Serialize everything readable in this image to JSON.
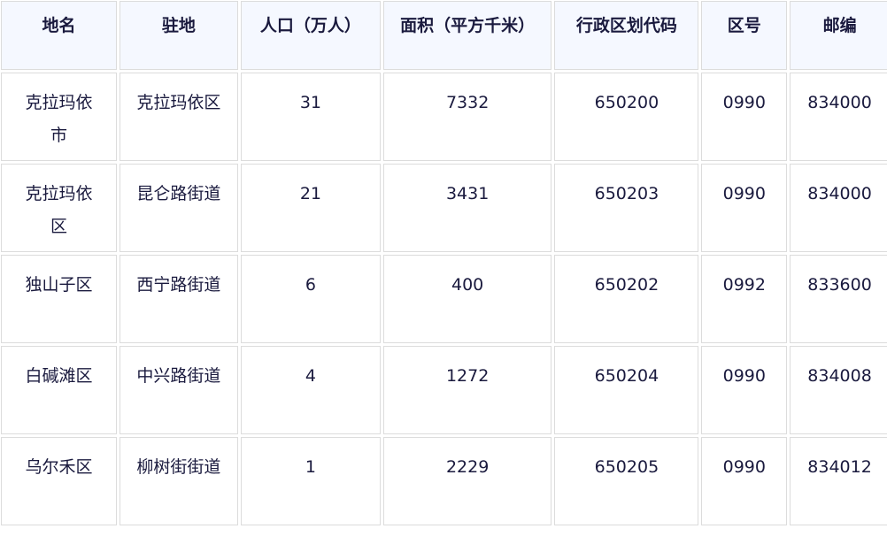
{
  "table": {
    "headers": [
      "地名",
      "驻地",
      "人口（万人）",
      "面积（平方千米）",
      "行政区划代码",
      "区号",
      "邮编"
    ],
    "rows": [
      [
        "克拉玛依市",
        "克拉玛依区",
        "31",
        "7332",
        "650200",
        "0990",
        "834000"
      ],
      [
        "克拉玛依区",
        "昆仑路街道",
        "21",
        "3431",
        "650203",
        "0990",
        "834000"
      ],
      [
        "独山子区",
        "西宁路街道",
        "6",
        "400",
        "650202",
        "0992",
        "833600"
      ],
      [
        "白碱滩区",
        "中兴路街道",
        "4",
        "1272",
        "650204",
        "0990",
        "834008"
      ],
      [
        "乌尔禾区",
        "柳树街街道",
        "1",
        "2229",
        "650205",
        "0990",
        "834012"
      ]
    ]
  },
  "colors": {
    "header_bg": "#f5f8ff",
    "border": "#dcdcdc",
    "text": "#1a1a3e"
  }
}
